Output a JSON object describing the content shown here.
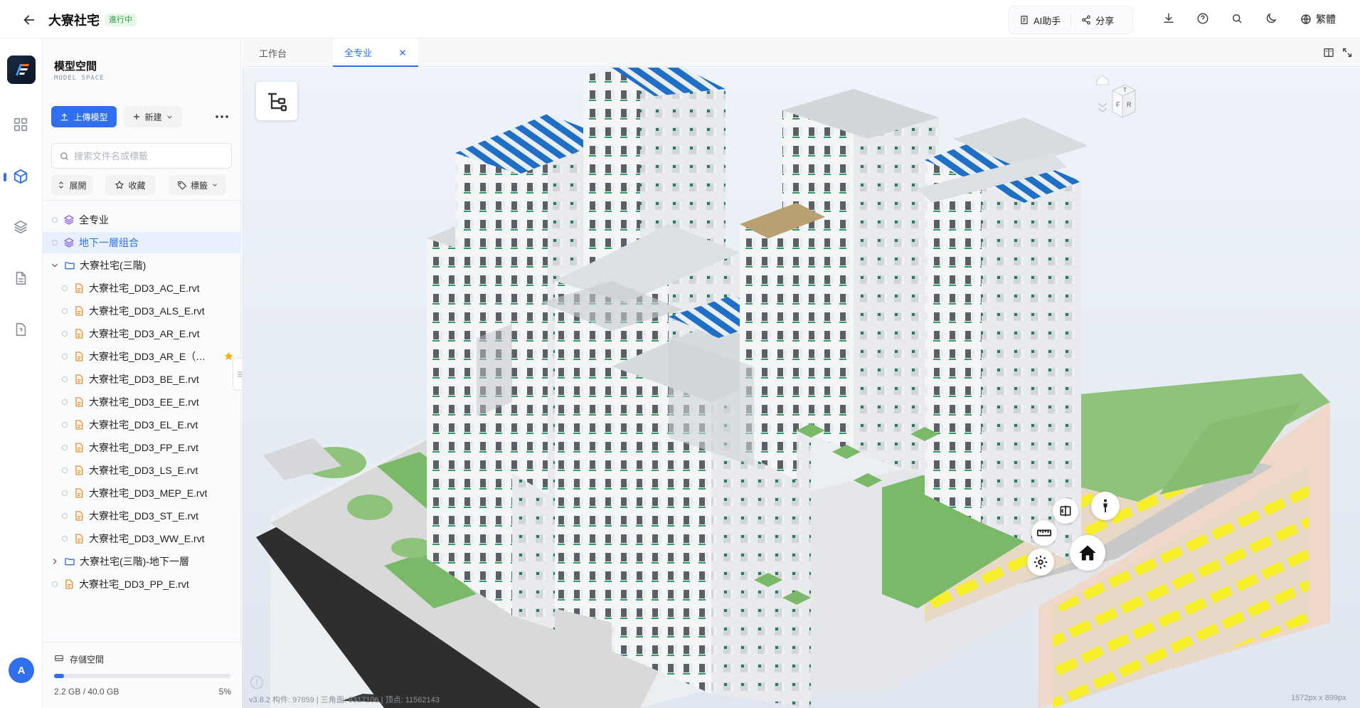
{
  "header": {
    "project_title": "大寮社宅",
    "status": "進行中",
    "ai_label": "AI助手",
    "share_label": "分享",
    "lang_label": "繁體"
  },
  "panel": {
    "title": "模型空間",
    "subtitle": "MODEL SPACE",
    "upload_label": "上傳模型",
    "new_label": "新建",
    "search_placeholder": "搜索文件名或標籤",
    "expand_label": "展開",
    "favorite_label": "收藏",
    "tag_label": "標籤"
  },
  "tree": [
    {
      "label": "全专业",
      "type": "layer"
    },
    {
      "label": "地下一層组合",
      "type": "layer",
      "selected": true
    },
    {
      "label": "大寮社宅(三階)",
      "type": "folder",
      "expanded": true
    },
    {
      "label": "大寮社宅_DD3_AC_E.rvt",
      "type": "file"
    },
    {
      "label": "大寮社宅_DD3_ALS_E.rvt",
      "type": "file"
    },
    {
      "label": "大寮社宅_DD3_AR_E.rvt",
      "type": "file"
    },
    {
      "label": "大寮社宅_DD3_AR_E（帶...",
      "type": "file",
      "starred": true
    },
    {
      "label": "大寮社宅_DD3_BE_E.rvt",
      "type": "file"
    },
    {
      "label": "大寮社宅_DD3_EE_E.rvt",
      "type": "file"
    },
    {
      "label": "大寮社宅_DD3_EL_E.rvt",
      "type": "file"
    },
    {
      "label": "大寮社宅_DD3_FP_E.rvt",
      "type": "file"
    },
    {
      "label": "大寮社宅_DD3_LS_E.rvt",
      "type": "file"
    },
    {
      "label": "大寮社宅_DD3_MEP_E.rvt",
      "type": "file"
    },
    {
      "label": "大寮社宅_DD3_ST_E.rvt",
      "type": "file"
    },
    {
      "label": "大寮社宅_DD3_WW_E.rvt",
      "type": "file"
    },
    {
      "label": "大寮社宅(三階)-地下一層",
      "type": "folder",
      "expanded": false
    },
    {
      "label": "大寮社宅_DD3_PP_E.rvt",
      "type": "file-root"
    }
  ],
  "storage": {
    "label": "存儲空間",
    "used": "2.2 GB / 40.0 GB",
    "percent": "5%",
    "fraction": 0.055
  },
  "avatar": "A",
  "tabs": [
    "工作台",
    "全专业"
  ],
  "viewer": {
    "stats": "v3.8.2   构件: 97859 | 三角面: 8317106 | 顶点: 11562143",
    "dims": "1572px x 899px",
    "cube_faces": [
      "F",
      "R",
      "T"
    ]
  },
  "colors": {
    "accent": "#2f6fed",
    "status_bg": "#e8f7ea",
    "status_fg": "#2f9e44"
  }
}
